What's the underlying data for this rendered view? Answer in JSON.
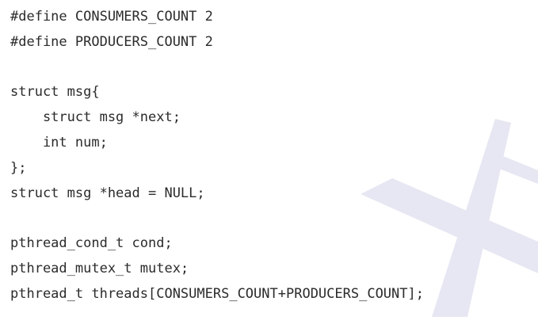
{
  "code": {
    "language": "c",
    "lines": [
      "#define CONSUMERS_COUNT 2",
      "#define PRODUCERS_COUNT 2",
      "",
      "struct msg{",
      "    struct msg *next;",
      "    int num;",
      "};",
      "struct msg *head = NULL;",
      "",
      "pthread_cond_t cond;",
      "pthread_mutex_t mutex;",
      "pthread_t threads[CONSUMERS_COUNT+PRODUCERS_COUNT];"
    ]
  },
  "watermark": {
    "icon": "watermark-cross-logo",
    "color": "#e6e7f2"
  },
  "colors": {
    "background": "#ffffff",
    "text": "#2b2b2b"
  }
}
